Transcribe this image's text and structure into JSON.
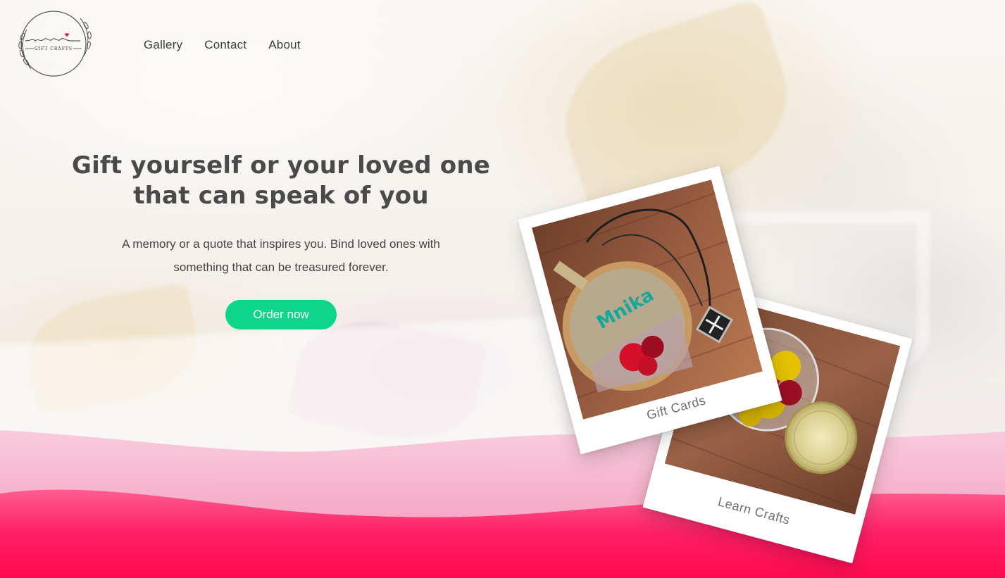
{
  "brand": {
    "logo_text": "GIFT CRAFTS",
    "logo_alt": "Gift Crafts logo"
  },
  "nav": {
    "items": [
      "Gallery",
      "Contact",
      "About"
    ]
  },
  "hero": {
    "title": "Gift yourself or your loved one that can speak of you",
    "subtitle": "A memory or a quote that inspires you. Bind loved ones with something that can be treasured forever.",
    "cta_label": "Order now"
  },
  "cards": [
    {
      "caption": "Gift Cards",
      "embroidery_text": "Mnika"
    },
    {
      "caption": "Learn Crafts"
    }
  ],
  "colors": {
    "accent": "#0ed48c",
    "wave_pink": "#ff0a55",
    "wave_light": "#f7b3cc",
    "heading": "#4a4a4a"
  }
}
